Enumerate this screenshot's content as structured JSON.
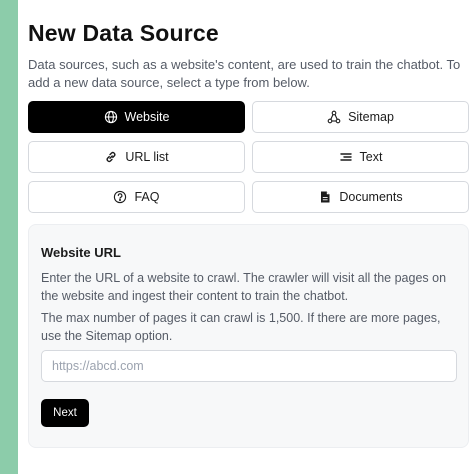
{
  "header": {
    "title": "New Data Source",
    "description": "Data sources, such as a website's content, are used to train the chatbot. To add a new data source, select a type from below."
  },
  "source_types": [
    {
      "label": "Website",
      "icon": "globe-icon",
      "selected": true
    },
    {
      "label": "Sitemap",
      "icon": "sitemap-icon",
      "selected": false
    },
    {
      "label": "URL list",
      "icon": "link-icon",
      "selected": false
    },
    {
      "label": "Text",
      "icon": "text-lines-icon",
      "selected": false
    },
    {
      "label": "FAQ",
      "icon": "question-circle-icon",
      "selected": false
    },
    {
      "label": "Documents",
      "icon": "document-icon",
      "selected": false
    }
  ],
  "website_form": {
    "title": "Website URL",
    "paragraph1": "Enter the URL of a website to crawl. The crawler will visit all the pages on the website and ingest their content to train the chatbot.",
    "paragraph2": "The max number of pages it can crawl is 1,500. If there are more pages, use the Sitemap option.",
    "url_value": "",
    "url_placeholder": "https://abcd.com",
    "next_label": "Next"
  },
  "colors": {
    "background": "#8cccaa",
    "selected_button": "#000000",
    "card_background": "#f7f8f9"
  }
}
